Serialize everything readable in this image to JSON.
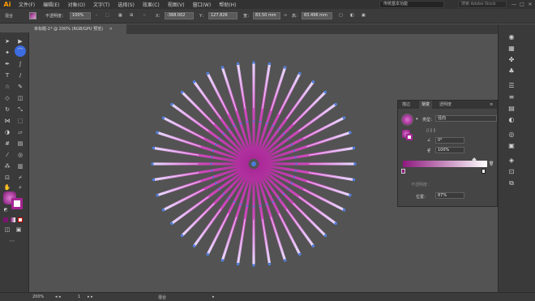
{
  "app": {
    "logo": "Ai"
  },
  "menubar": {
    "items": [
      "文件(F)",
      "编辑(E)",
      "对象(O)",
      "文字(T)",
      "选择(S)",
      "效果(C)",
      "视图(V)",
      "窗口(W)",
      "帮助(H)"
    ],
    "workspace": "传统基本功能",
    "search_placeholder": "搜索 Adobe Stock",
    "win_min": "—",
    "win_max": "□",
    "win_close": "✕"
  },
  "controlbar": {
    "mode_label": "混合",
    "opacity_label": "不透明度：",
    "opacity_value": "100%",
    "x_label": "X：",
    "x_value": "-368.002",
    "y_label": "Y：",
    "y_value": "127.826",
    "w_label": "宽：",
    "w_value": "83.50 mm",
    "h_label": "高：",
    "h_value": "83.496 mm"
  },
  "document": {
    "tab_title": "未标题-1* @ 200% (RGB/GPU 预览)",
    "close": "✕"
  },
  "gradient_panel": {
    "tabs": [
      "描边",
      "渐变",
      "透明度"
    ],
    "type_label": "类型：",
    "type_value": "径向",
    "angle_value": "0°",
    "aspect_value": "100%",
    "blend_label": "不透明度：",
    "position_label": "位置：",
    "position_value": "87%",
    "stop_start_color": "#8e1a7e",
    "stop_end_color": "#ffffff"
  },
  "statusbar": {
    "zoom": "200%",
    "page": "1",
    "mode": "混合"
  },
  "colors": {
    "accent": "#ff9a00",
    "stroke_purple": "#a52593",
    "ray_highlight": "#e9d7ff",
    "anchor_blue": "#4a7bdc"
  },
  "artwork": {
    "ray_count": 40
  }
}
